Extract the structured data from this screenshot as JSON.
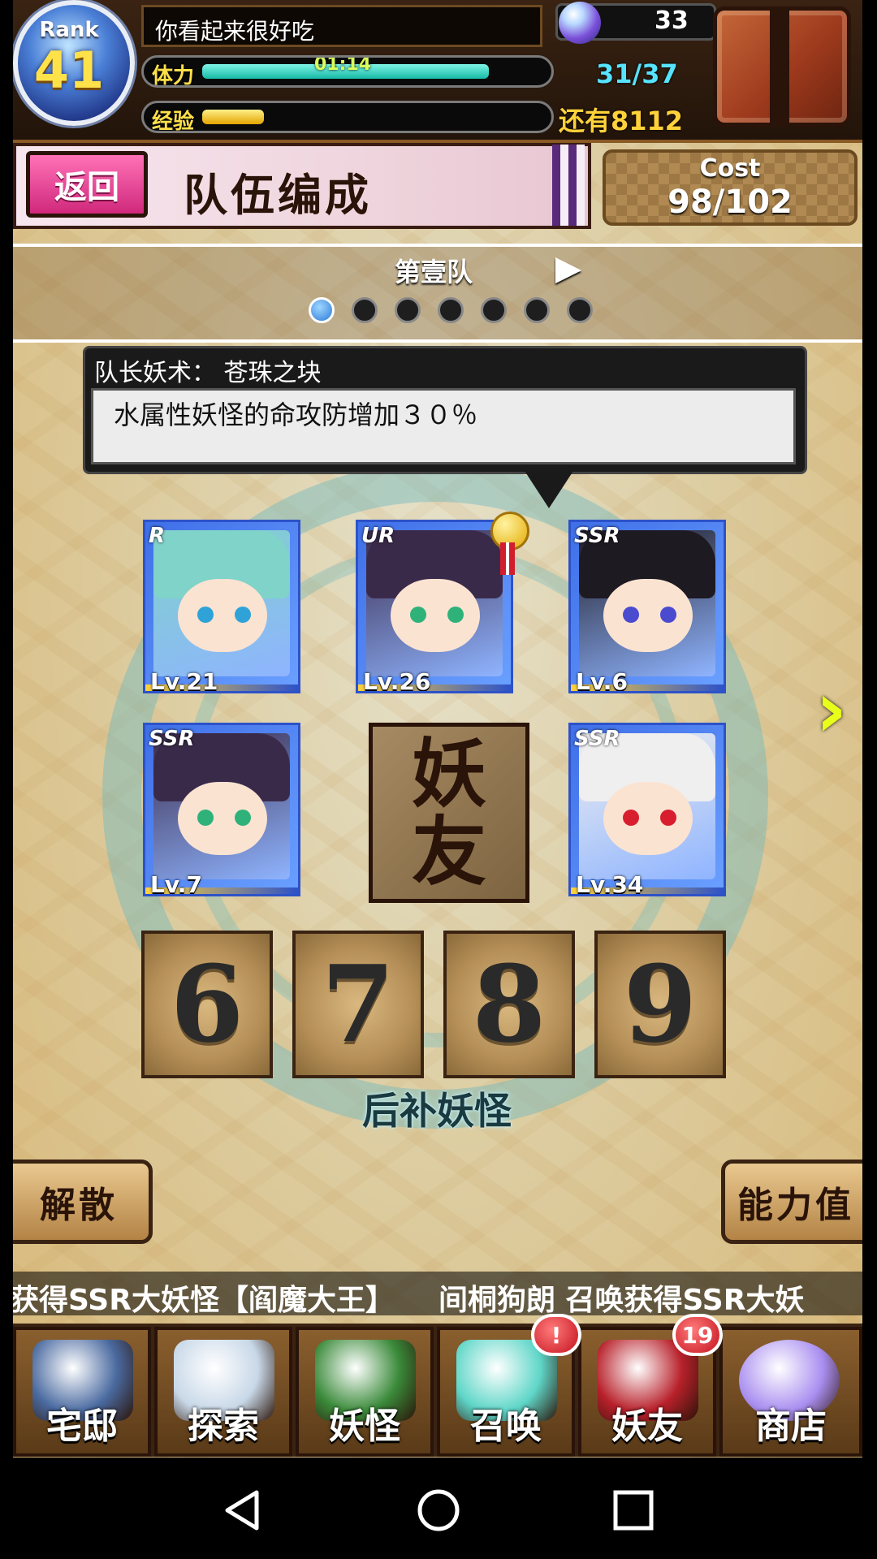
{
  "status": {
    "rank_label": "Rank",
    "rank_value": "41",
    "player_name": "你看起来很好吃",
    "stamina_label": "体力",
    "stamina_timer": "01:14",
    "stamina_value": "31/37",
    "stamina_fraction": 0.84,
    "exp_label": "经验",
    "exp_value": "还有8112",
    "exp_fraction": 0.18,
    "orb_count": "33"
  },
  "header": {
    "back_label": "返回",
    "title": "队伍编成",
    "cost_label": "Cost",
    "cost_value": "98/102"
  },
  "team": {
    "label": "第壹队",
    "pages": 7,
    "active_page": 1
  },
  "leader_skill": {
    "title": "队长妖术： 苍珠之块",
    "description": "水属性妖怪的命攻防增加３０％"
  },
  "cards": [
    {
      "rarity": "R",
      "level": "Lv.21",
      "hair": "#7fd3c9",
      "eye": "#2fa3d8"
    },
    {
      "rarity": "UR",
      "level": "Lv.26",
      "hair": "#3a2a4a",
      "eye": "#2fb27a"
    },
    {
      "rarity": "SSR",
      "level": "Lv.6",
      "hair": "#1e1a22",
      "eye": "#4b4bd0"
    },
    {
      "rarity": "SSR",
      "level": "Lv.7",
      "hair": "#3a2a4a",
      "eye": "#2fb27a"
    },
    {
      "rarity": "SSR",
      "level": "Lv.34",
      "hair": "#efefef",
      "eye": "#d81e2e"
    }
  ],
  "friend_slot": {
    "top": "妖",
    "bottom": "友"
  },
  "reserve": {
    "numbers": [
      "6",
      "7",
      "8",
      "9"
    ],
    "label": "后补妖怪"
  },
  "actions": {
    "disband": "解散",
    "stats": "能力值"
  },
  "ticker": "获得SSR大妖怪【阎魔大王】　　间桐狗朗 召唤获得SSR大妖",
  "nav": [
    {
      "label": "宅邸",
      "badge": null,
      "color": "#4a6aa0"
    },
    {
      "label": "探索",
      "badge": null,
      "color": "#c8d8e8"
    },
    {
      "label": "妖怪",
      "badge": null,
      "color": "#3a8a3a"
    },
    {
      "label": "召唤",
      "badge": "!",
      "color": "#5fd6c8"
    },
    {
      "label": "妖友",
      "badge": "19",
      "color": "#b8202a"
    },
    {
      "label": "商店",
      "badge": null,
      "color": "#a98ef0"
    }
  ],
  "colors": {
    "accent_pink": "#e0408c",
    "stamina_bar": "#2ed6c0",
    "exp_bar": "#ffd23a",
    "stamina_text": "#56e3ff",
    "exp_text": "#ffd23a"
  }
}
